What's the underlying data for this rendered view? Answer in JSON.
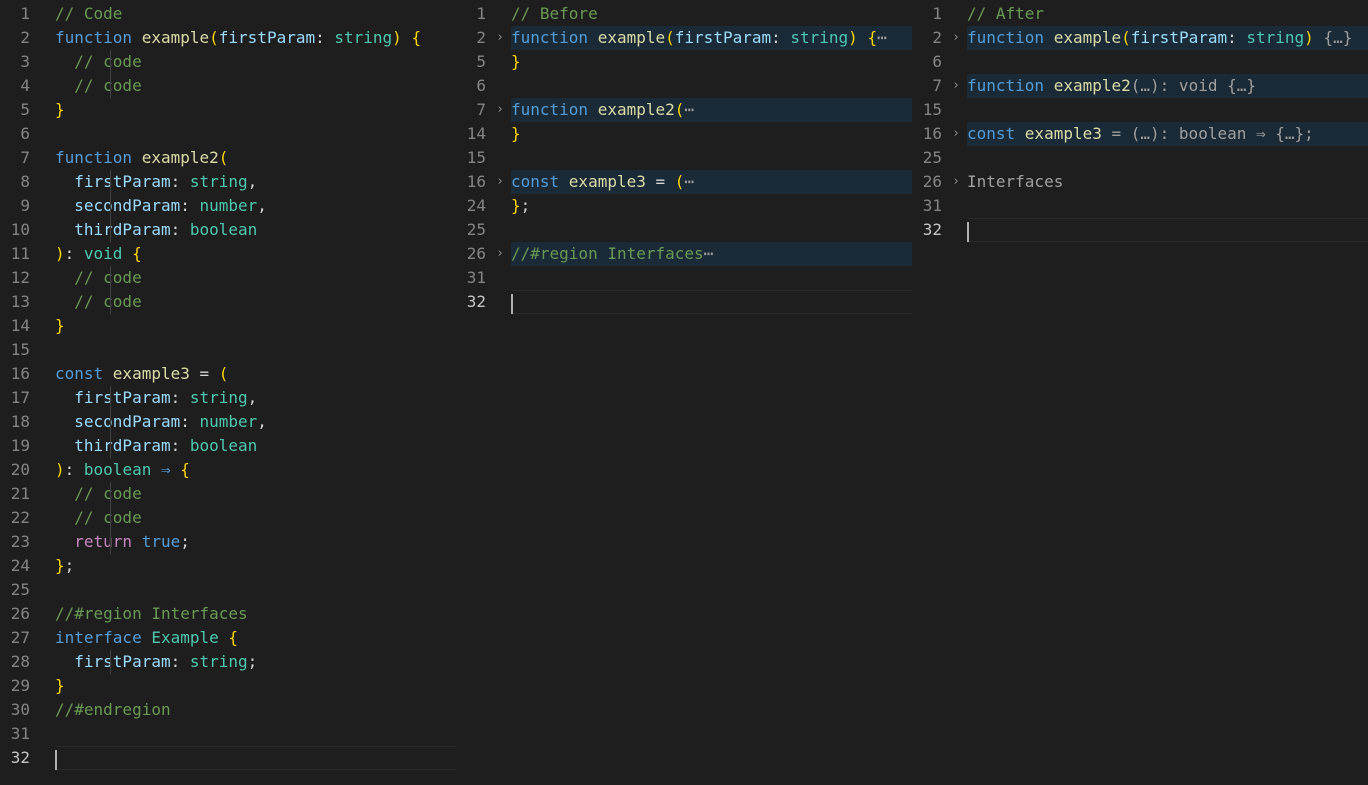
{
  "colors": {
    "background": "#1e1e1e",
    "folded_line_highlight": "#1a2a36",
    "comment": "#6a9955",
    "keyword": "#569cd6",
    "function": "#dcdcaa",
    "parameter": "#9cdcfe",
    "type": "#4ec9b0",
    "brace": "#ffd700",
    "control": "#c586c0"
  },
  "icons": {
    "fold_toggle": "chevron-right-icon"
  },
  "panes": [
    {
      "name": "code",
      "lines": [
        {
          "n": "1",
          "tokens": [
            {
              "t": "// Code",
              "c": "comment"
            }
          ]
        },
        {
          "n": "2",
          "tokens": [
            {
              "t": "function ",
              "c": "kw"
            },
            {
              "t": "example",
              "c": "fn"
            },
            {
              "t": "(",
              "c": "brace"
            },
            {
              "t": "firstParam",
              "c": "param"
            },
            {
              "t": ": ",
              "c": "punc"
            },
            {
              "t": "string",
              "c": "type"
            },
            {
              "t": ") {",
              "c": "brace"
            }
          ]
        },
        {
          "n": "3",
          "guide": true,
          "tokens": [
            {
              "t": "  // code",
              "c": "comment"
            }
          ]
        },
        {
          "n": "4",
          "guide": true,
          "tokens": [
            {
              "t": "  // code",
              "c": "comment"
            }
          ]
        },
        {
          "n": "5",
          "tokens": [
            {
              "t": "}",
              "c": "brace"
            }
          ]
        },
        {
          "n": "6",
          "tokens": []
        },
        {
          "n": "7",
          "tokens": [
            {
              "t": "function ",
              "c": "kw"
            },
            {
              "t": "example2",
              "c": "fn"
            },
            {
              "t": "(",
              "c": "brace"
            }
          ]
        },
        {
          "n": "8",
          "guide": true,
          "tokens": [
            {
              "t": "  firstParam",
              "c": "param"
            },
            {
              "t": ": ",
              "c": "punc"
            },
            {
              "t": "string",
              "c": "type"
            },
            {
              "t": ",",
              "c": "punc"
            }
          ]
        },
        {
          "n": "9",
          "guide": true,
          "tokens": [
            {
              "t": "  secondParam",
              "c": "param"
            },
            {
              "t": ": ",
              "c": "punc"
            },
            {
              "t": "number",
              "c": "type"
            },
            {
              "t": ",",
              "c": "punc"
            }
          ]
        },
        {
          "n": "10",
          "guide": true,
          "tokens": [
            {
              "t": "  thirdParam",
              "c": "param"
            },
            {
              "t": ": ",
              "c": "punc"
            },
            {
              "t": "boolean",
              "c": "type"
            }
          ]
        },
        {
          "n": "11",
          "tokens": [
            {
              "t": ")",
              "c": "brace"
            },
            {
              "t": ": ",
              "c": "punc"
            },
            {
              "t": "void",
              "c": "type"
            },
            {
              "t": " {",
              "c": "brace"
            }
          ]
        },
        {
          "n": "12",
          "guide": true,
          "tokens": [
            {
              "t": "  // code",
              "c": "comment"
            }
          ]
        },
        {
          "n": "13",
          "guide": true,
          "tokens": [
            {
              "t": "  // code",
              "c": "comment"
            }
          ]
        },
        {
          "n": "14",
          "tokens": [
            {
              "t": "}",
              "c": "brace"
            }
          ]
        },
        {
          "n": "15",
          "tokens": []
        },
        {
          "n": "16",
          "tokens": [
            {
              "t": "const ",
              "c": "kw"
            },
            {
              "t": "example3",
              "c": "fn"
            },
            {
              "t": " = ",
              "c": "punc"
            },
            {
              "t": "(",
              "c": "brace"
            }
          ]
        },
        {
          "n": "17",
          "guide": true,
          "tokens": [
            {
              "t": "  firstParam",
              "c": "param"
            },
            {
              "t": ": ",
              "c": "punc"
            },
            {
              "t": "string",
              "c": "type"
            },
            {
              "t": ",",
              "c": "punc"
            }
          ]
        },
        {
          "n": "18",
          "guide": true,
          "tokens": [
            {
              "t": "  secondParam",
              "c": "param"
            },
            {
              "t": ": ",
              "c": "punc"
            },
            {
              "t": "number",
              "c": "type"
            },
            {
              "t": ",",
              "c": "punc"
            }
          ]
        },
        {
          "n": "19",
          "guide": true,
          "tokens": [
            {
              "t": "  thirdParam",
              "c": "param"
            },
            {
              "t": ": ",
              "c": "punc"
            },
            {
              "t": "boolean",
              "c": "type"
            }
          ]
        },
        {
          "n": "20",
          "tokens": [
            {
              "t": ")",
              "c": "brace"
            },
            {
              "t": ": ",
              "c": "punc"
            },
            {
              "t": "boolean",
              "c": "type"
            },
            {
              "t": " ⇒ ",
              "c": "kw"
            },
            {
              "t": "{",
              "c": "brace"
            }
          ]
        },
        {
          "n": "21",
          "guide": true,
          "tokens": [
            {
              "t": "  // code",
              "c": "comment"
            }
          ]
        },
        {
          "n": "22",
          "guide": true,
          "tokens": [
            {
              "t": "  // code",
              "c": "comment"
            }
          ]
        },
        {
          "n": "23",
          "guide": true,
          "tokens": [
            {
              "t": "  return ",
              "c": "ctrl"
            },
            {
              "t": "true",
              "c": "kw"
            },
            {
              "t": ";",
              "c": "punc"
            }
          ]
        },
        {
          "n": "24",
          "tokens": [
            {
              "t": "}",
              "c": "brace"
            },
            {
              "t": ";",
              "c": "punc"
            }
          ]
        },
        {
          "n": "25",
          "tokens": []
        },
        {
          "n": "26",
          "tokens": [
            {
              "t": "//#region Interfaces",
              "c": "region"
            }
          ]
        },
        {
          "n": "27",
          "tokens": [
            {
              "t": "interface ",
              "c": "kw"
            },
            {
              "t": "Example",
              "c": "type"
            },
            {
              "t": " {",
              "c": "brace"
            }
          ]
        },
        {
          "n": "28",
          "guide": true,
          "tokens": [
            {
              "t": "  firstParam",
              "c": "param"
            },
            {
              "t": ": ",
              "c": "punc"
            },
            {
              "t": "string",
              "c": "type"
            },
            {
              "t": ";",
              "c": "punc"
            }
          ]
        },
        {
          "n": "29",
          "tokens": [
            {
              "t": "}",
              "c": "brace"
            }
          ]
        },
        {
          "n": "30",
          "tokens": [
            {
              "t": "//#endregion",
              "c": "region"
            }
          ]
        },
        {
          "n": "31",
          "tokens": []
        },
        {
          "n": "32",
          "current": true,
          "tokens": []
        }
      ]
    },
    {
      "name": "before",
      "lines": [
        {
          "n": "1",
          "tokens": [
            {
              "t": "// Before",
              "c": "comment"
            }
          ]
        },
        {
          "n": "2",
          "folded": true,
          "tokens": [
            {
              "t": "function ",
              "c": "kw"
            },
            {
              "t": "example",
              "c": "fn"
            },
            {
              "t": "(",
              "c": "brace"
            },
            {
              "t": "firstParam",
              "c": "param"
            },
            {
              "t": ": ",
              "c": "punc"
            },
            {
              "t": "string",
              "c": "type"
            },
            {
              "t": ") {",
              "c": "brace"
            },
            {
              "t": "⋯",
              "c": "summary"
            }
          ]
        },
        {
          "n": "5",
          "tokens": [
            {
              "t": "}",
              "c": "brace"
            }
          ]
        },
        {
          "n": "6",
          "tokens": []
        },
        {
          "n": "7",
          "folded": true,
          "tokens": [
            {
              "t": "function ",
              "c": "kw"
            },
            {
              "t": "example2",
              "c": "fn"
            },
            {
              "t": "(",
              "c": "brace"
            },
            {
              "t": "⋯",
              "c": "summary"
            }
          ]
        },
        {
          "n": "14",
          "tokens": [
            {
              "t": "}",
              "c": "brace"
            }
          ]
        },
        {
          "n": "15",
          "tokens": []
        },
        {
          "n": "16",
          "folded": true,
          "tokens": [
            {
              "t": "const ",
              "c": "kw"
            },
            {
              "t": "example3",
              "c": "fn"
            },
            {
              "t": " = ",
              "c": "punc"
            },
            {
              "t": "(",
              "c": "brace"
            },
            {
              "t": "⋯",
              "c": "summary"
            }
          ]
        },
        {
          "n": "24",
          "tokens": [
            {
              "t": "}",
              "c": "brace"
            },
            {
              "t": ";",
              "c": "punc"
            }
          ]
        },
        {
          "n": "25",
          "tokens": []
        },
        {
          "n": "26",
          "folded": true,
          "tokens": [
            {
              "t": "//#region Interfaces",
              "c": "region"
            },
            {
              "t": "⋯",
              "c": "summary"
            }
          ]
        },
        {
          "n": "31",
          "tokens": []
        },
        {
          "n": "32",
          "current": true,
          "tokens": []
        }
      ]
    },
    {
      "name": "after",
      "lines": [
        {
          "n": "1",
          "tokens": [
            {
              "t": "// After",
              "c": "comment"
            }
          ]
        },
        {
          "n": "2",
          "folded": true,
          "tokens": [
            {
              "t": "function ",
              "c": "kw"
            },
            {
              "t": "example",
              "c": "fn"
            },
            {
              "t": "(",
              "c": "brace"
            },
            {
              "t": "firstParam",
              "c": "param"
            },
            {
              "t": ": ",
              "c": "punc"
            },
            {
              "t": "string",
              "c": "type"
            },
            {
              "t": ") ",
              "c": "brace"
            },
            {
              "t": "{…}",
              "c": "summary"
            }
          ]
        },
        {
          "n": "6",
          "tokens": []
        },
        {
          "n": "7",
          "folded": true,
          "tokens": [
            {
              "t": "function ",
              "c": "kw"
            },
            {
              "t": "example2",
              "c": "fn"
            },
            {
              "t": "(…): void {…}",
              "c": "summary"
            }
          ]
        },
        {
          "n": "15",
          "tokens": []
        },
        {
          "n": "16",
          "folded": true,
          "tokens": [
            {
              "t": "const ",
              "c": "kw"
            },
            {
              "t": "example3",
              "c": "fn"
            },
            {
              "t": " = (…): boolean ⇒ {…};",
              "c": "summary"
            }
          ]
        },
        {
          "n": "25",
          "tokens": []
        },
        {
          "n": "26",
          "folded": true,
          "plain": true,
          "tokens": [
            {
              "t": "Interfaces",
              "c": "summary"
            }
          ]
        },
        {
          "n": "31",
          "tokens": []
        },
        {
          "n": "32",
          "current": true,
          "tokens": []
        }
      ]
    }
  ]
}
